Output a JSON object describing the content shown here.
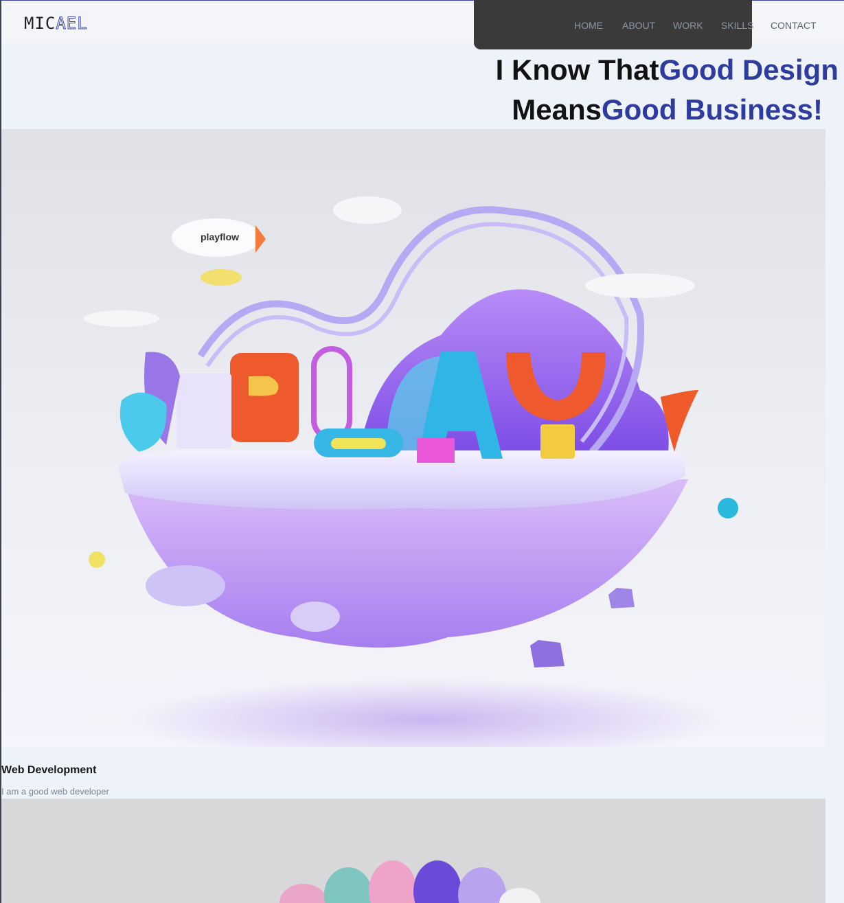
{
  "brand": {
    "part1": "MIC",
    "part2": "AEL"
  },
  "nav": {
    "home": "HOME",
    "about": "ABOUT",
    "work": "WORK",
    "skills": "SKILLS",
    "contact": "CONTACT"
  },
  "hero": {
    "line1_dark": "I Know That",
    "line1_blue": "Good Design",
    "line2_dark": "Means",
    "line2_blue": "Good Business!"
  },
  "illustration": {
    "blimp_text": "playflow"
  },
  "project": {
    "title": "Web Development",
    "description": "I am a good web developer"
  },
  "colors": {
    "accent": "#2d3c9e",
    "background": "#eef2f9",
    "header_bg": "#f3f5f9"
  }
}
